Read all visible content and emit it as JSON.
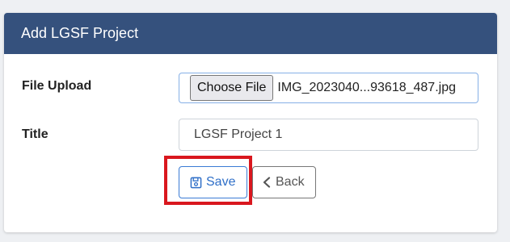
{
  "panel": {
    "title": "Add LGSF Project"
  },
  "form": {
    "file_upload_label": "File Upload",
    "choose_file_label": "Choose File",
    "file_name": "IMG_2023040...93618_487.jpg",
    "title_label": "Title",
    "title_value": "LGSF Project 1"
  },
  "actions": {
    "save_label": "Save",
    "save_icon": "floppy-disk-icon",
    "back_label": "Back",
    "back_icon": "chevron-left-icon"
  },
  "colors": {
    "header_bg": "#35517d",
    "primary": "#2f6fc8",
    "highlight": "#d9171e"
  }
}
